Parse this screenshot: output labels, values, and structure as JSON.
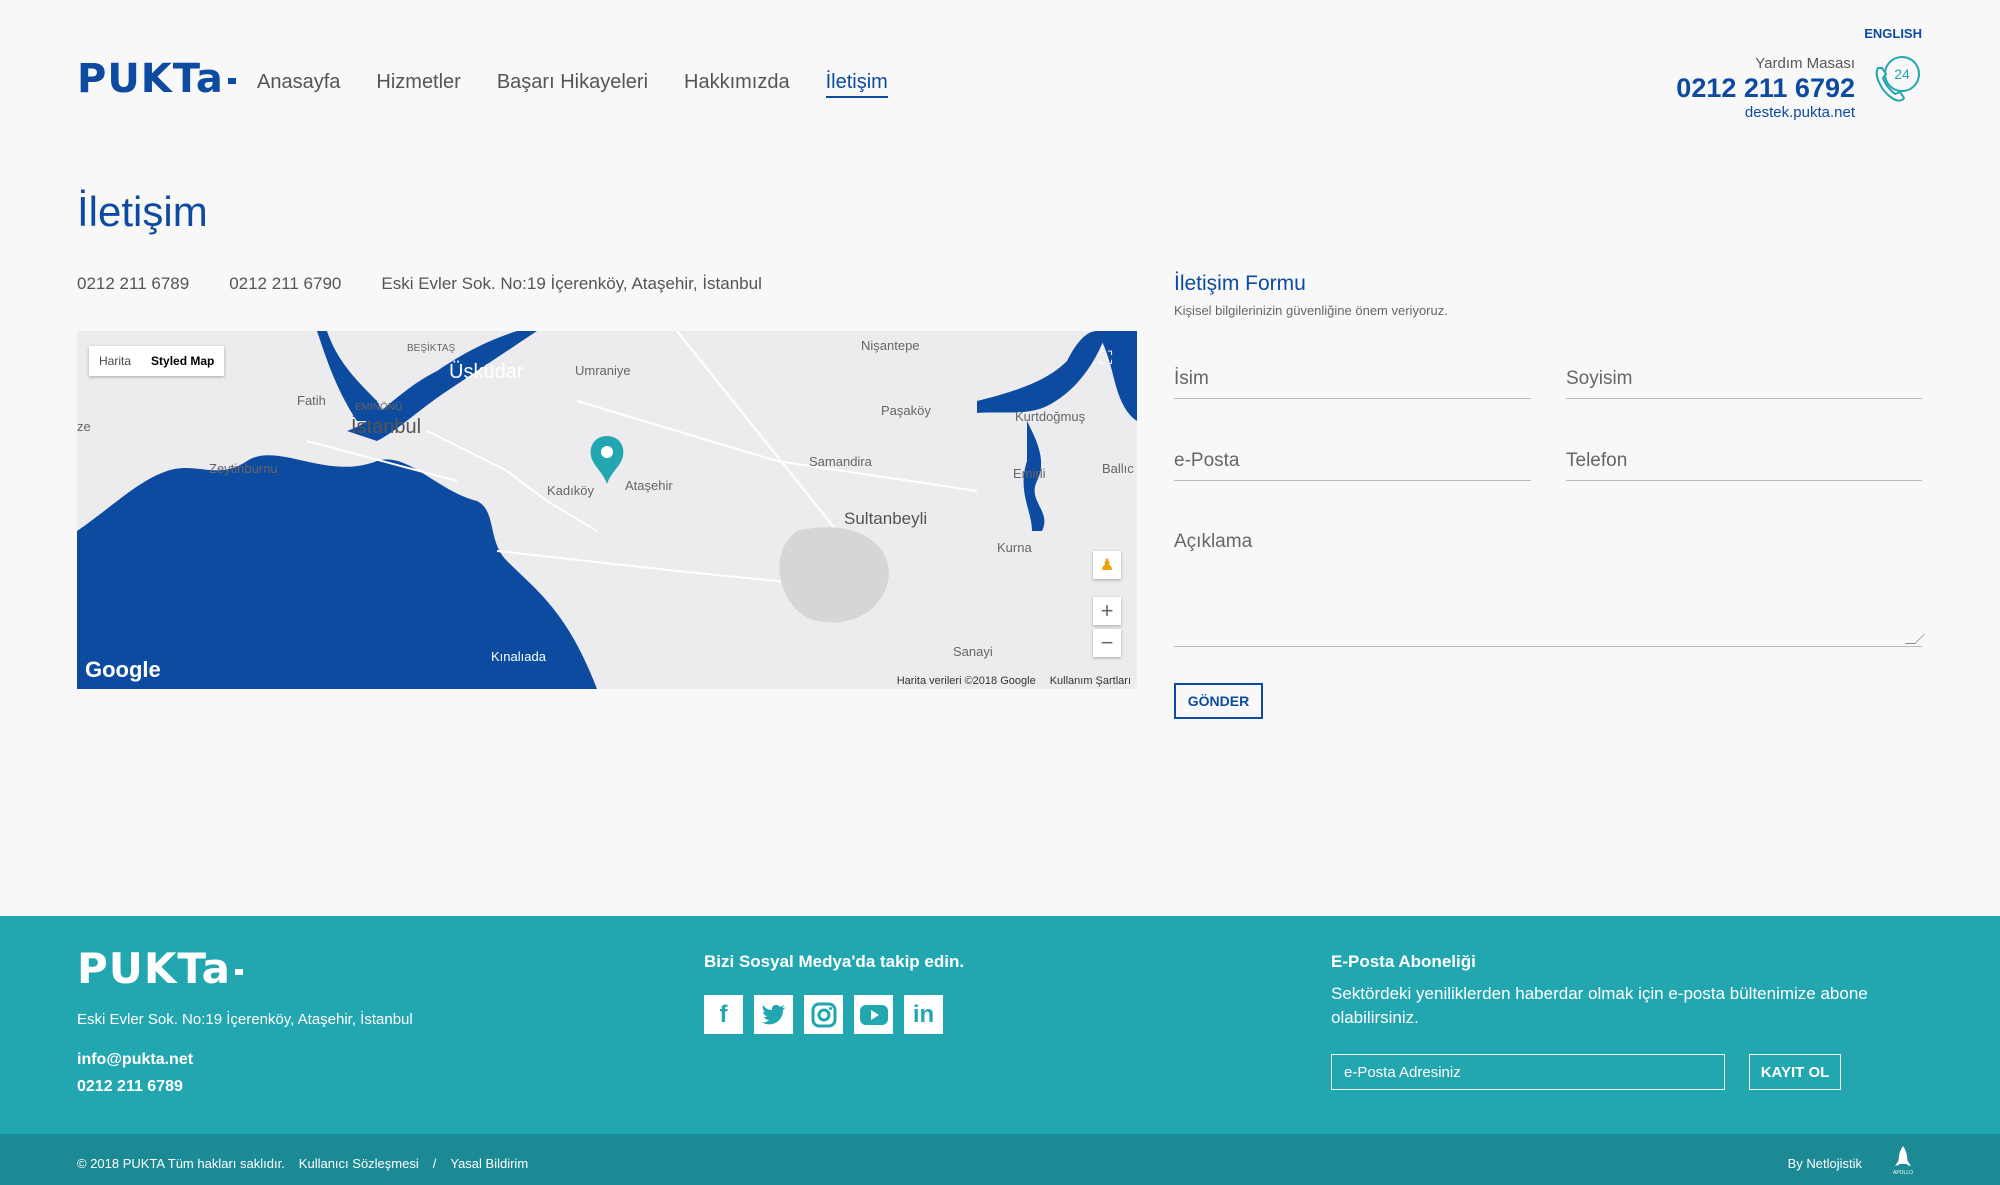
{
  "header": {
    "logo": "PUKTa",
    "nav": [
      "Anasayfa",
      "Hizmetler",
      "Başarı Hikayeleri",
      "Hakkımızda",
      "İletişim"
    ],
    "lang": "ENGLISH",
    "help_label": "Yardım Masası",
    "help_phone": "0212 211 6792",
    "help_mail": "destek.pukta.net",
    "help_badge": "24"
  },
  "page": {
    "title": "İletişim",
    "phone1": "0212 211 6789",
    "phone2": "0212 211 6790",
    "address": "Eski Evler Sok. No:19 İçerenköy, Ataşehir, İstanbul"
  },
  "map": {
    "type_map": "Harita",
    "type_styled": "Styled Map",
    "labels": [
      "BEŞİKTAŞ",
      "Üsküdar",
      "Umraniye",
      "Fatih",
      "EMİNÖNÜ",
      "İstanbul",
      "Zeytinburnu",
      "Kadıköy",
      "Ataşehir",
      "Nişantepe",
      "Paşaköy",
      "Kurtdoğmuş",
      "Samandira",
      "Sultanbeyli",
      "Emirli",
      "Ballıc",
      "Kurna",
      "Kınalıada",
      "Sanayi",
      "ze"
    ],
    "google": "Google",
    "data_credit": "Harita verileri ©2018 Google",
    "terms": "Kullanım Şartları",
    "water_color": "#0d4ba0",
    "pin_color": "#22a7b1"
  },
  "form": {
    "title": "İletişim Formu",
    "subtitle": "Kişisel bilgilerinizin güvenliğine önem veriyoruz.",
    "name": "İsim",
    "surname": "Soyisim",
    "email": "e-Posta",
    "phone": "Telefon",
    "description": "Açıklama",
    "submit": "GÖNDER"
  },
  "footer": {
    "logo": "PUKTa",
    "address": "Eski Evler Sok. No:19 İçerenköy, Ataşehir, İstanbul",
    "email": "info@pukta.net",
    "phone": "0212 211 6789",
    "social_title": "Bizi Sosyal Medya'da takip edin.",
    "social_icons": [
      "facebook-icon",
      "twitter-icon",
      "instagram-icon",
      "youtube-icon",
      "linkedin-icon"
    ],
    "sub_title": "E-Posta Aboneliği",
    "sub_desc": "Sektördeki yeniliklerden haberdar olmak için e-posta bültenimize abone olabilirsiniz.",
    "sub_placeholder": "e-Posta Adresiniz",
    "sub_button": "KAYIT OL",
    "copyright": "© 2018 PUKTA Tüm hakları saklıdır.",
    "terms": "Kullanıcı Sözleşmesi",
    "separator": "/",
    "legal": "Yasal Bildirim",
    "by": "By Netlojistik",
    "apollo": "APOLLO",
    "bg": "#22a7b1",
    "bottom_bg": "#1b8a94"
  }
}
